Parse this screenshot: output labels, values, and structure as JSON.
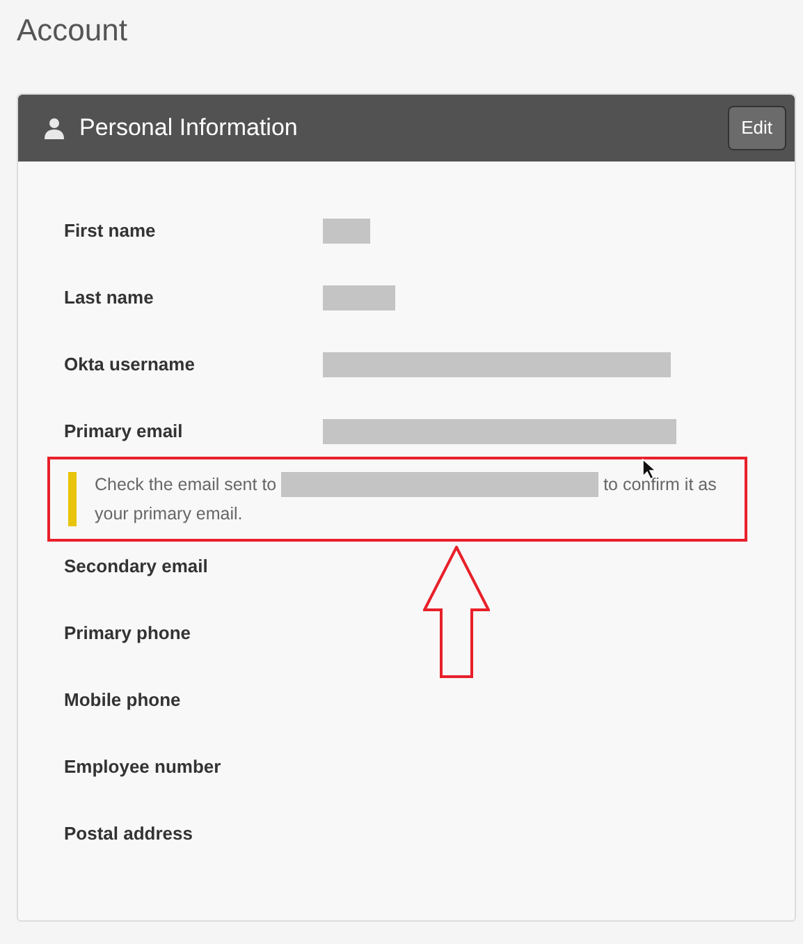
{
  "page_title": "Account",
  "card": {
    "title": "Personal Information",
    "edit_button": "Edit"
  },
  "rows": [
    {
      "kind": "field",
      "label": "First name",
      "redacted": true
    },
    {
      "kind": "field",
      "label": "Last name",
      "redacted": true
    },
    {
      "kind": "field",
      "label": "Okta username",
      "redacted": true
    },
    {
      "kind": "field",
      "label": "Primary email",
      "redacted": true
    },
    {
      "kind": "notice",
      "text_before": "Check the email sent to",
      "text_after": "to confirm it as your primary email.",
      "redacted": true
    },
    {
      "kind": "field",
      "label": "Secondary email",
      "redacted": false
    },
    {
      "kind": "field",
      "label": "Primary phone",
      "redacted": false
    },
    {
      "kind": "field",
      "label": "Mobile phone",
      "redacted": false
    },
    {
      "kind": "field",
      "label": "Employee number",
      "redacted": false
    },
    {
      "kind": "field",
      "label": "Postal address",
      "redacted": false
    }
  ]
}
